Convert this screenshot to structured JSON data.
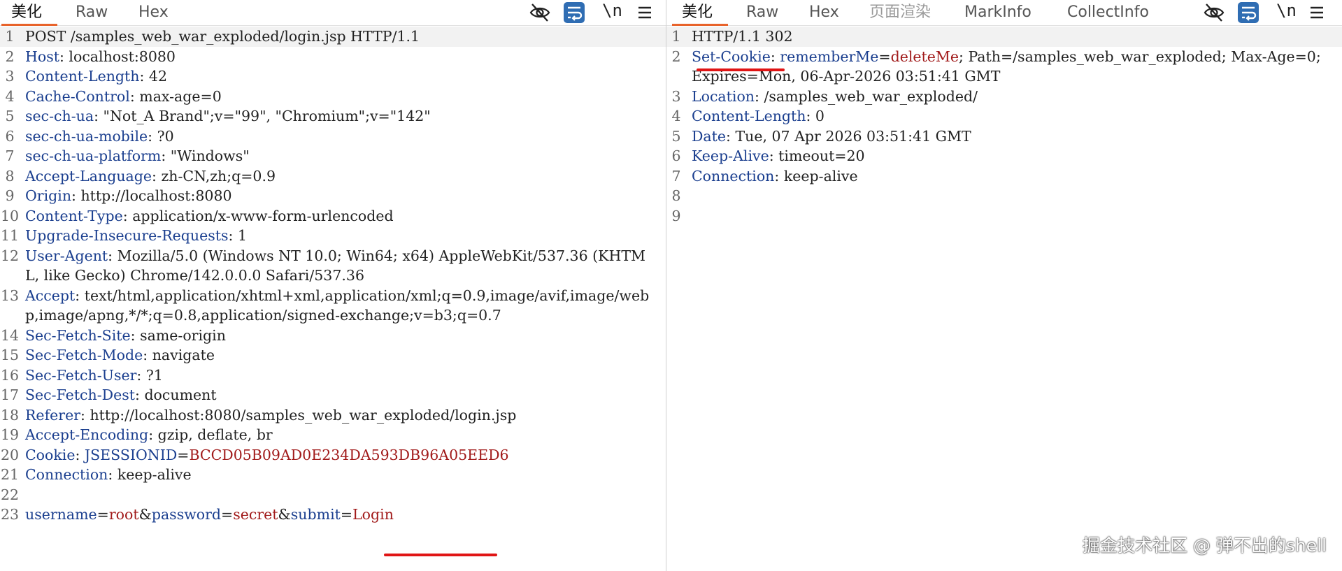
{
  "left": {
    "tabs": [
      {
        "label": "美化",
        "active": true
      },
      {
        "label": "Raw",
        "active": false
      },
      {
        "label": "Hex",
        "active": false
      }
    ],
    "tools": {
      "eye_icon": "eye-slash-icon",
      "wrap_icon": "wrap-icon",
      "newline_label": "\\n",
      "menu_icon": "hamburger-menu-icon"
    },
    "lines": [
      {
        "n": "1",
        "text": "POST /samples_web_war_exploded/login.jsp HTTP/1.1"
      },
      {
        "n": "2",
        "name": "Host",
        "value": "localhost:8080"
      },
      {
        "n": "3",
        "name": "Content-Length",
        "value": "42"
      },
      {
        "n": "4",
        "name": "Cache-Control",
        "value": "max-age=0"
      },
      {
        "n": "5",
        "name": "sec-ch-ua",
        "value": "\"Not_A Brand\";v=\"99\", \"Chromium\";v=\"142\""
      },
      {
        "n": "6",
        "name": "sec-ch-ua-mobile",
        "value": "?0"
      },
      {
        "n": "7",
        "name": "sec-ch-ua-platform",
        "value": "\"Windows\""
      },
      {
        "n": "8",
        "name": "Accept-Language",
        "value": "zh-CN,zh;q=0.9"
      },
      {
        "n": "9",
        "name": "Origin",
        "value": "http://localhost:8080"
      },
      {
        "n": "10",
        "name": "Content-Type",
        "value": "application/x-www-form-urlencoded"
      },
      {
        "n": "11",
        "name": "Upgrade-Insecure-Requests",
        "value": "1"
      },
      {
        "n": "12",
        "name": "User-Agent",
        "value": "Mozilla/5.0 (Windows NT 10.0; Win64; x64) AppleWebKit/537.36 (KHTML, like Gecko) Chrome/142.0.0.0 Safari/537.36"
      },
      {
        "n": "13",
        "name": "Accept",
        "value": "text/html,application/xhtml+xml,application/xml;q=0.9,image/avif,image/webp,image/apng,*/*;q=0.8,application/signed-exchange;v=b3;q=0.7"
      },
      {
        "n": "14",
        "name": "Sec-Fetch-Site",
        "value": "same-origin"
      },
      {
        "n": "15",
        "name": "Sec-Fetch-Mode",
        "value": "navigate"
      },
      {
        "n": "16",
        "name": "Sec-Fetch-User",
        "value": "?1"
      },
      {
        "n": "17",
        "name": "Sec-Fetch-Dest",
        "value": "document"
      },
      {
        "n": "18",
        "name": "Referer",
        "value": "http://localhost:8080/samples_web_war_exploded/login.jsp"
      },
      {
        "n": "19",
        "name": "Accept-Encoding",
        "value": "gzip, deflate, br"
      },
      {
        "n": "20",
        "name": "Cookie",
        "cookie": [
          {
            "k": "JSESSIONID",
            "v": "BCCD05B09AD0E234DA593DB96A05EED6"
          }
        ]
      },
      {
        "n": "21",
        "name": "Connection",
        "value": "keep-alive"
      },
      {
        "n": "22",
        "text": ""
      },
      {
        "n": "23",
        "params": [
          {
            "k": "username",
            "v": "root"
          },
          {
            "k": "password",
            "v": "secret"
          },
          {
            "k": "submit",
            "v": "Login"
          }
        ]
      }
    ]
  },
  "right": {
    "tabs": [
      {
        "label": "美化",
        "active": true
      },
      {
        "label": "Raw",
        "active": false
      },
      {
        "label": "Hex",
        "active": false
      },
      {
        "label": "页面渲染",
        "active": false,
        "dim": true
      },
      {
        "label": "MarkInfo",
        "active": false
      },
      {
        "label": "CollectInfo",
        "active": false
      }
    ],
    "tools": {
      "eye_icon": "eye-slash-icon",
      "wrap_icon": "wrap-icon",
      "newline_label": "\\n",
      "menu_icon": "hamburger-menu-icon"
    },
    "lines": [
      {
        "n": "1",
        "text": "HTTP/1.1 302"
      },
      {
        "n": "2",
        "name": "Set-Cookie",
        "cookie": [
          {
            "k": "rememberMe",
            "v": "deleteMe"
          }
        ],
        "rest": "; Path=/samples_web_war_exploded; Max-Age=0; Expires=Mon, 06-Apr-2026 03:51:41 GMT"
      },
      {
        "n": "3",
        "name": "Location",
        "value": "/samples_web_war_exploded/"
      },
      {
        "n": "4",
        "name": "Content-Length",
        "value": "0"
      },
      {
        "n": "5",
        "name": "Date",
        "value": "Tue, 07 Apr 2026 03:51:41 GMT"
      },
      {
        "n": "6",
        "name": "Keep-Alive",
        "value": "timeout=20"
      },
      {
        "n": "7",
        "name": "Connection",
        "value": "keep-alive"
      },
      {
        "n": "8",
        "text": ""
      },
      {
        "n": "9",
        "text": ""
      }
    ]
  },
  "watermark": "掘金技术社区 @ 弹不出的shell",
  "colors": {
    "accent": "#e8632b",
    "header_name": "#1b3f8f",
    "param_value": "#a11a1a",
    "underline": "#e01515",
    "wrap_button": "#2f6db3"
  }
}
